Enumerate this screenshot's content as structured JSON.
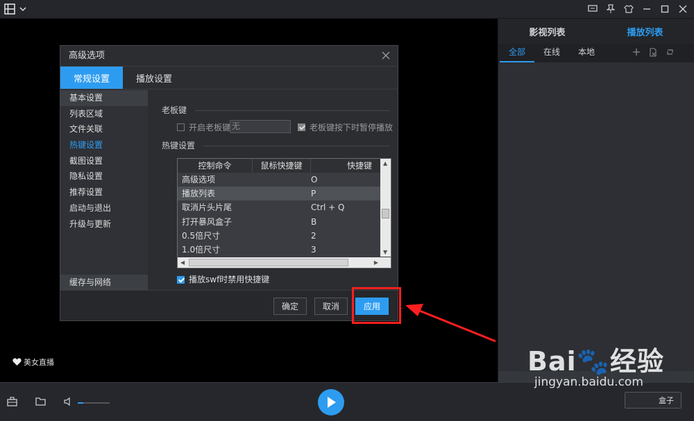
{
  "top_bar": {
    "icons": [
      "list-view-icon",
      "chevron-down-icon",
      "message-icon",
      "pin-icon",
      "skin-icon",
      "minimize-icon",
      "maximize-icon",
      "close-icon"
    ]
  },
  "right_panel": {
    "tabs": [
      "影视列表",
      "播放列表"
    ],
    "active_tab": "播放列表",
    "sub_tabs": [
      "全部",
      "在线",
      "本地"
    ],
    "active_sub_tab": "全部"
  },
  "video": {
    "live_label": "美女直播"
  },
  "dialog": {
    "title": "高级选项",
    "tabs": [
      "常规设置",
      "播放设置"
    ],
    "nav": [
      "基本设置",
      "列表区域",
      "文件关联",
      "热键设置",
      "截图设置",
      "隐私设置",
      "推荐设置",
      "启动与退出",
      "升级与更新"
    ],
    "nav_bottom": "缓存与网络",
    "boss_key": {
      "section": "老板键",
      "enable_label": "开启老板键",
      "input_value": "无",
      "pause_label": "老板键按下时暂停播放"
    },
    "hotkeys": {
      "section": "热键设置",
      "columns": [
        "控制命令",
        "鼠标快捷键",
        "快捷键"
      ],
      "rows": [
        {
          "command": "高级选项",
          "key": "O"
        },
        {
          "command": "播放列表",
          "key": "P"
        },
        {
          "command": "取消片头片尾",
          "key": "Ctrl + Q"
        },
        {
          "command": "打开暴风盒子",
          "key": "B"
        },
        {
          "command": "0.5倍尺寸",
          "key": "2"
        },
        {
          "command": "1.0倍尺寸",
          "key": "3"
        }
      ],
      "swf_label": "播放swf时禁用快捷键"
    },
    "buttons": {
      "ok": "确定",
      "cancel": "取消",
      "apply": "应用"
    }
  },
  "bottom_bar": {
    "box_label": "盒子"
  },
  "watermark": {
    "logo": "Bai🐾经验",
    "url": "jingyan.baidu.com"
  },
  "colors": {
    "accent": "#2d9cf0",
    "highlight": "#ff1f1f"
  }
}
